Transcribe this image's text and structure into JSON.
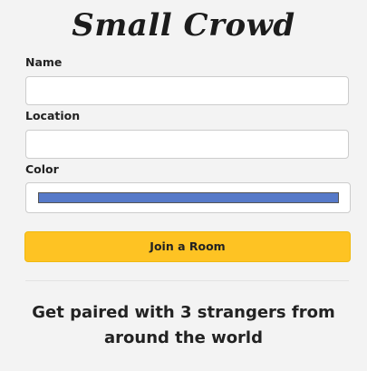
{
  "app": {
    "title": "Small Crowd"
  },
  "form": {
    "name_label": "Name",
    "name_value": "",
    "location_label": "Location",
    "location_value": "",
    "color_label": "Color",
    "color_value": "#5679c8",
    "join_button_label": "Join a Room"
  },
  "tagline": "Get paired with 3 strangers from around the world",
  "colors": {
    "background": "#f3f3f3",
    "button": "#fec323",
    "selected_color": "#5679c8"
  }
}
